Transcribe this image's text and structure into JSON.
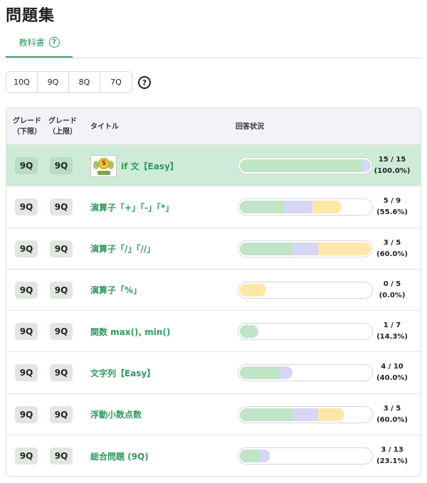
{
  "page": {
    "title": "問題集"
  },
  "tabs": [
    {
      "label": "教科書",
      "help": "?"
    }
  ],
  "grades": {
    "options": [
      "10Q",
      "9Q",
      "8Q",
      "7Q"
    ],
    "help": "?"
  },
  "table": {
    "headers": {
      "grade_lo": [
        "グレード",
        "（下限）"
      ],
      "grade_hi": [
        "グレード",
        "（上限）"
      ],
      "title": "タイトル",
      "status": "回答状況"
    },
    "rows": [
      {
        "lo": "9Q",
        "hi": "9Q",
        "title": "if 文【Easy】",
        "thumbnail": "trophy-coin-image",
        "done": true,
        "segments": [
          0.933,
          0.067,
          0
        ],
        "count": "15 / 15",
        "pct": "(100.0%)"
      },
      {
        "lo": "9Q",
        "hi": "9Q",
        "title": "演算子「+」「-」「*」",
        "done": false,
        "segments": [
          0.333,
          0.222,
          0.222
        ],
        "count": "5 / 9",
        "pct": "(55.6%)"
      },
      {
        "lo": "9Q",
        "hi": "9Q",
        "title": "演算子「/」「//」",
        "done": false,
        "segments": [
          0.4,
          0.2,
          0.4
        ],
        "count": "3 / 5",
        "pct": "(60.0%)"
      },
      {
        "lo": "9Q",
        "hi": "9Q",
        "title": "演算子「%」",
        "done": false,
        "segments": [
          0,
          0,
          0.2
        ],
        "count": "0 / 5",
        "pct": "(0.0%)"
      },
      {
        "lo": "9Q",
        "hi": "9Q",
        "title": "関数 max(), min()",
        "done": false,
        "segments": [
          0.143,
          0,
          0
        ],
        "count": "1 / 7",
        "pct": "(14.3%)"
      },
      {
        "lo": "9Q",
        "hi": "9Q",
        "title": "文字列【Easy】",
        "done": false,
        "segments": [
          0.3,
          0.1,
          0
        ],
        "count": "4 / 10",
        "pct": "(40.0%)"
      },
      {
        "lo": "9Q",
        "hi": "9Q",
        "title": "浮動小数点数",
        "done": false,
        "segments": [
          0.4,
          0.2,
          0.2
        ],
        "count": "3 / 5",
        "pct": "(60.0%)"
      },
      {
        "lo": "9Q",
        "hi": "9Q",
        "title": "総合問題 (9Q)",
        "done": false,
        "segments": [
          0.154,
          0.077,
          0
        ],
        "count": "3 / 13",
        "pct": "(23.1%)"
      }
    ]
  },
  "colors": {
    "accent": "#2f9a5f",
    "done_row": "#cdebd7",
    "seg_correct": "#bfe4c6",
    "seg_partial": "#d6d7f4",
    "seg_wrong": "#fde7a8"
  }
}
